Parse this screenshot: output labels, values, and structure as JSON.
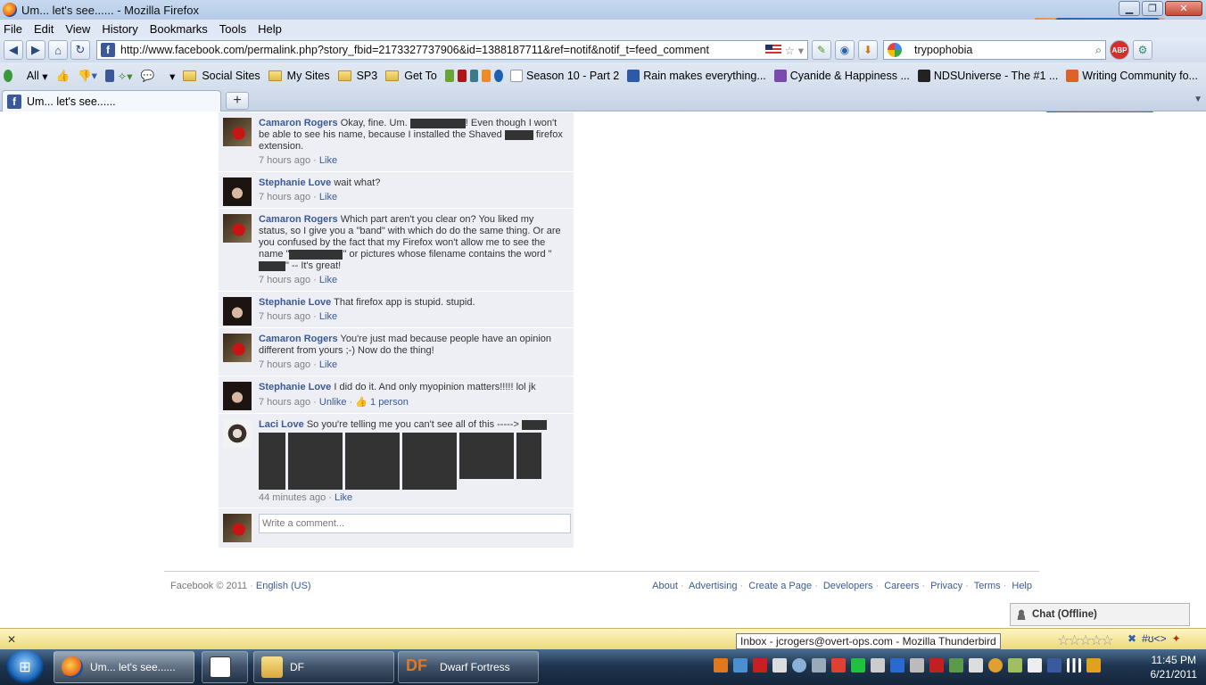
{
  "window": {
    "title": "Um... let's see...... - Mozilla Firefox"
  },
  "menu": [
    "File",
    "Edit",
    "View",
    "History",
    "Bookmarks",
    "Tools",
    "Help"
  ],
  "nav": {
    "url": "http://www.facebook.com/permalink.php?story_fbid=2173327737906&id=1388187711&ref=notif&notif_t=feed_comment",
    "search_value": "trypophobia"
  },
  "bookmarks": {
    "all_label": "All",
    "items": [
      "Social Sites",
      "My Sites",
      "SP3",
      "Get To",
      "Season 10 - Part 2",
      "Rain makes everything...",
      "Cyanide & Happiness ...",
      "NDSUniverse - The #1 ...",
      "Writing Community fo..."
    ]
  },
  "tab": {
    "title": "Um... let's see......"
  },
  "comments": [
    {
      "name": "Camaron Rogers",
      "avatar": "cam",
      "parts": [
        "Okay, fine. Um. ",
        "! Even though I won't be able to see his name, because I installed the Shaved ",
        " firefox extension."
      ],
      "time": "7 hours ago",
      "like": "Like"
    },
    {
      "name": "Stephanie Love",
      "avatar": "steph",
      "parts": [
        "wait what?"
      ],
      "time": "7 hours ago",
      "like": "Like"
    },
    {
      "name": "Camaron Rogers",
      "avatar": "cam",
      "parts": [
        "Which part aren't you clear on? You liked my status, so I give you a \"band\" with which do do the same thing. Or are you confused by the fact that my Firefox won't allow me to see the name \"",
        "\" or pictures whose filename contains the word \"",
        "\" -- It's great!"
      ],
      "time": "7 hours ago",
      "like": "Like"
    },
    {
      "name": "Stephanie Love",
      "avatar": "steph",
      "parts": [
        "That firefox app is stupid. stupid."
      ],
      "time": "7 hours ago",
      "like": "Like"
    },
    {
      "name": "Camaron Rogers",
      "avatar": "cam",
      "parts": [
        "You're just mad because people have an opinion different from yours ;-) Now do the thing!"
      ],
      "time": "7 hours ago",
      "like": "Like"
    },
    {
      "name": "Stephanie Love",
      "avatar": "steph",
      "parts": [
        "I did do it. And only myopinion matters!!!!! lol jk"
      ],
      "time": "7 hours ago",
      "like": "Unlike",
      "likes_count": "1 person"
    },
    {
      "name": "Laci Love",
      "avatar": "laci",
      "parts": [
        "So you're telling me you can't see all of this -----> "
      ],
      "time": "44 minutes ago",
      "like": "Like"
    }
  ],
  "write_placeholder": "Write a comment...",
  "footer": {
    "copyright": "Facebook © 2011",
    "language": "English (US)",
    "links": [
      "About",
      "Advertising",
      "Create a Page",
      "Developers",
      "Careers",
      "Privacy",
      "Terms",
      "Help"
    ]
  },
  "chat": {
    "label": "Chat (Offline)"
  },
  "status": {
    "tooltip": "Inbox - jcrogers@overt-ops.com - Mozilla Thunderbird",
    "tail": "#ʊ<>"
  },
  "taskbar": {
    "tasks": [
      "Um... let's see......",
      "DF",
      "Dwarf Fortress"
    ],
    "time": "11:45 PM",
    "date": "6/21/2011"
  },
  "colors": {
    "fb_blue": "#3b5998",
    "comment_bg": "#edeff4",
    "redaction": "#333333"
  }
}
